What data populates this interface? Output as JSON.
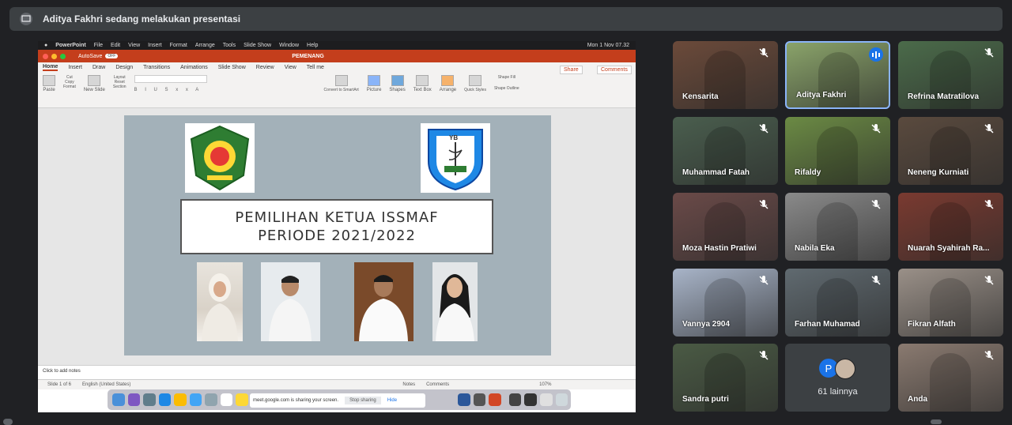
{
  "header": {
    "presenting_text": "Aditya Fakhri sedang melakukan presentasi"
  },
  "screen": {
    "mac_menu": [
      "PowerPoint",
      "File",
      "Edit",
      "View",
      "Insert",
      "Format",
      "Arrange",
      "Tools",
      "Slide Show",
      "Window",
      "Help"
    ],
    "mac_clock": "Mon 1 Nov 07.32",
    "autosave_label": "AutoSave",
    "autosave_state": "OFF",
    "document_title": "PEMENANG",
    "ribbon_tabs": [
      "Home",
      "Insert",
      "Draw",
      "Design",
      "Transitions",
      "Animations",
      "Slide Show",
      "Review",
      "View",
      "Tell me"
    ],
    "share_label": "Share",
    "comments_label": "Comments",
    "ribbon_buttons": [
      "Paste",
      "Cut",
      "Copy",
      "Format",
      "New Slide",
      "Layout",
      "Reset",
      "Section",
      "Convert to SmartArt",
      "Picture",
      "Shapes",
      "Text Box",
      "Arrange",
      "Quick Styles",
      "Shape Fill",
      "Shape Outline"
    ],
    "slide": {
      "title_line1": "PEMILIHAN KETUA ISSMAF",
      "title_line2": "PERIODE 2021/2022",
      "right_logo_text": "YB"
    },
    "notes_placeholder": "Click to add notes",
    "status": {
      "slide_count": "Slide 1 of 6",
      "language": "English (United States)",
      "notes": "Notes",
      "comments": "Comments",
      "zoom": "107%"
    },
    "sharing_text": "meet.google.com is sharing your screen.",
    "stop_sharing": "Stop sharing",
    "hide": "Hide"
  },
  "participants": [
    {
      "name": "Kensarita",
      "muted": true,
      "bg": "#6b4a3a"
    },
    {
      "name": "Aditya Fakhri",
      "muted": false,
      "speaking": true,
      "bg": "#8aa36a"
    },
    {
      "name": "Refrina Matratilova",
      "muted": true,
      "bg": "#4b6b4a"
    },
    {
      "name": "Muhammad Fatah",
      "muted": true,
      "bg": "#4a5e4e"
    },
    {
      "name": "Rifaldy",
      "muted": true,
      "bg": "#6b8a44"
    },
    {
      "name": "Neneng Kurniati",
      "muted": true,
      "bg": "#5a4a3e"
    },
    {
      "name": "Moza Hastin Pratiwi",
      "muted": true,
      "bg": "#6a4a48"
    },
    {
      "name": "Nabila Eka",
      "muted": true,
      "bg": "#8a8a8a"
    },
    {
      "name": "Nuarah Syahirah Ra...",
      "muted": true,
      "bg": "#7a3a30"
    },
    {
      "name": "Vannya 2904",
      "muted": true,
      "bg": "#a8b4c8"
    },
    {
      "name": "Farhan Muhamad",
      "muted": true,
      "bg": "#606a70"
    },
    {
      "name": "Fikran Alfath",
      "muted": true,
      "bg": "#9a9088"
    },
    {
      "name": "Sandra putri",
      "muted": true,
      "bg": "#4a5a44"
    },
    {
      "more_label": "61 lainnya",
      "avatar_letter": "P"
    },
    {
      "name": "Anda",
      "muted": true,
      "bg": "#8a7a70"
    }
  ]
}
